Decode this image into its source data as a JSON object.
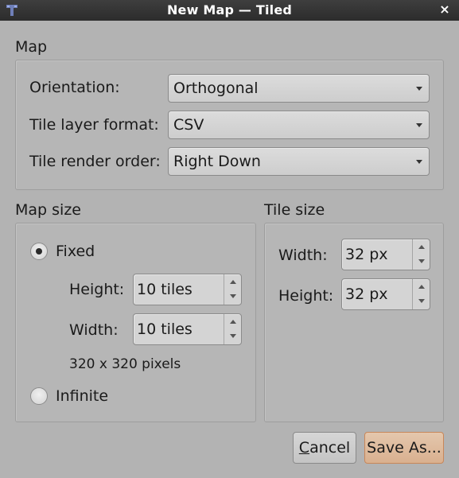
{
  "window": {
    "title": "New Map — Tiled",
    "close_glyph": "×",
    "app_icon": "tiled-icon"
  },
  "map": {
    "section_label": "Map",
    "orientation_label": "Orientation:",
    "orientation_value": "Orthogonal",
    "layer_format_label": "Tile layer format:",
    "layer_format_value": "CSV",
    "render_order_label": "Tile render order:",
    "render_order_value": "Right Down"
  },
  "map_size": {
    "section_label": "Map size",
    "fixed_label": "Fixed",
    "fixed_checked": true,
    "height_label": "Height:",
    "height_value": "10 tiles",
    "width_label": "Width:",
    "width_value": "10 tiles",
    "pixels_text": "320 x 320 pixels",
    "infinite_label": "Infinite",
    "infinite_checked": false
  },
  "tile_size": {
    "section_label": "Tile size",
    "width_label": "Width:",
    "width_value": "32 px",
    "height_label": "Height:",
    "height_value": "32 px"
  },
  "buttons": {
    "cancel_mnemonic": "C",
    "cancel_rest": "ancel",
    "save_as_label": "Save As..."
  }
}
